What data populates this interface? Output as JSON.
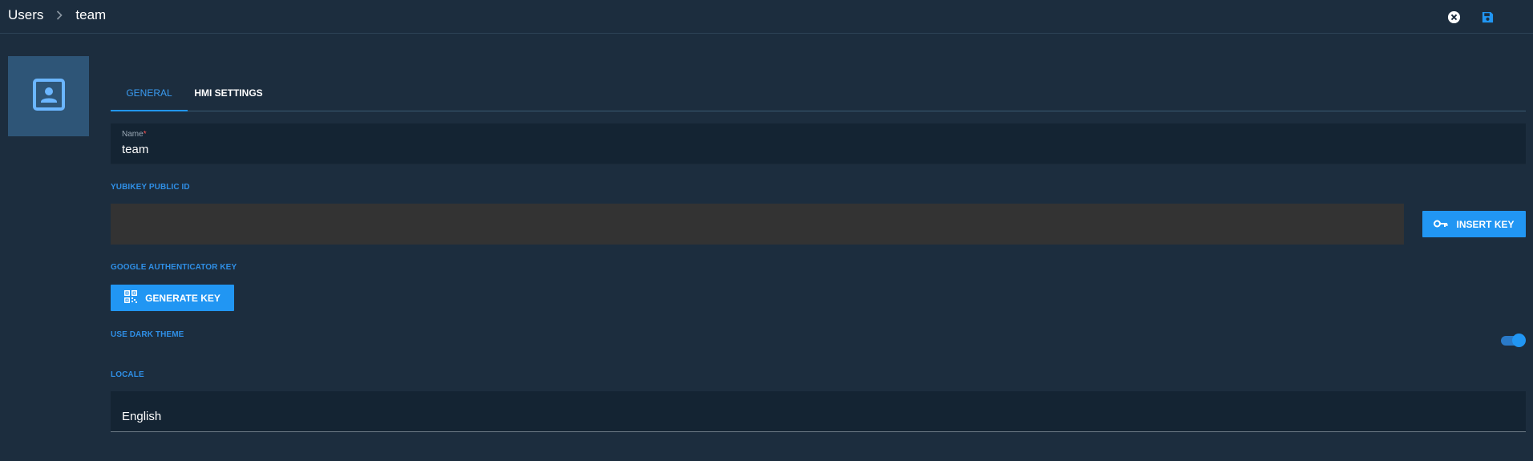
{
  "breadcrumb": {
    "parent": "Users",
    "current": "team"
  },
  "tabs": [
    {
      "label": "GENERAL",
      "active": true
    },
    {
      "label": "HMI SETTINGS",
      "active": false
    }
  ],
  "form": {
    "name": {
      "label": "Name",
      "required_mark": "*",
      "value": "team"
    },
    "yubikey": {
      "label": "YUBIKEY PUBLIC ID",
      "value": "",
      "button_label": "INSERT KEY"
    },
    "google_auth": {
      "label": "GOOGLE AUTHENTICATOR KEY",
      "button_label": "GENERATE KEY"
    },
    "dark_theme": {
      "label": "USE DARK THEME",
      "enabled": true
    },
    "locale": {
      "label": "LOCALE",
      "value": "English"
    }
  },
  "icons": {
    "breadcrumb_separator": "chevron-right-icon",
    "close": "close-circle-icon",
    "save": "floppy-disk-icon",
    "avatar": "account-box-icon",
    "key": "key-icon",
    "qrcode": "qrcode-icon"
  },
  "colors": {
    "background": "#1c2d3e",
    "accent": "#2196f3",
    "field_bg": "#142433",
    "disabled_field_bg": "#333333",
    "avatar_bg": "#2e5577"
  }
}
